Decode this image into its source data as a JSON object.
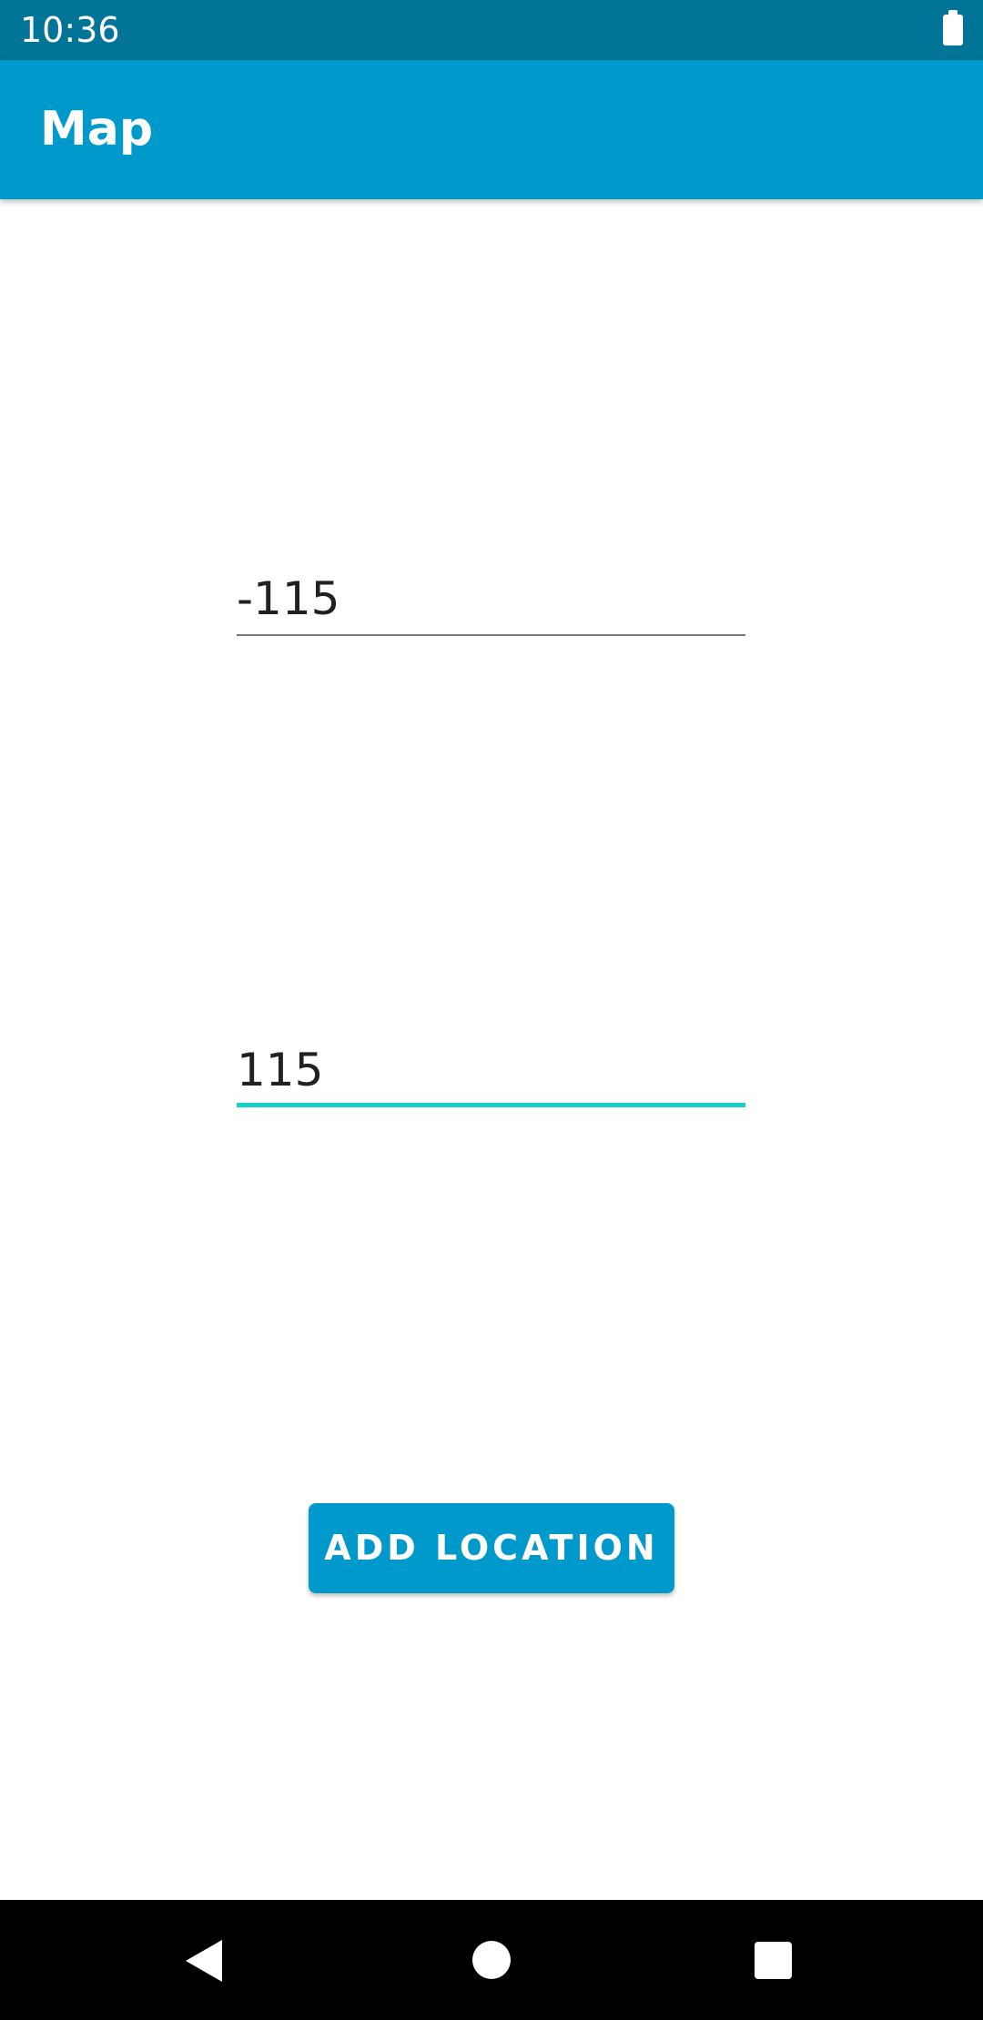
{
  "status_bar": {
    "time": "10:36",
    "battery_icon": "battery-full-icon"
  },
  "app_bar": {
    "title": "Map"
  },
  "form": {
    "longitude_value": "-115",
    "latitude_value": "115",
    "add_button_label": "ADD LOCATION"
  },
  "nav_bar": {
    "back_icon": "back-triangle-icon",
    "home_icon": "home-circle-icon",
    "recents_icon": "recents-square-icon"
  },
  "colors": {
    "status_bar": "#017497",
    "app_bar": "#0099cc",
    "focus_accent": "#17d0c8",
    "button": "#0099cc"
  }
}
